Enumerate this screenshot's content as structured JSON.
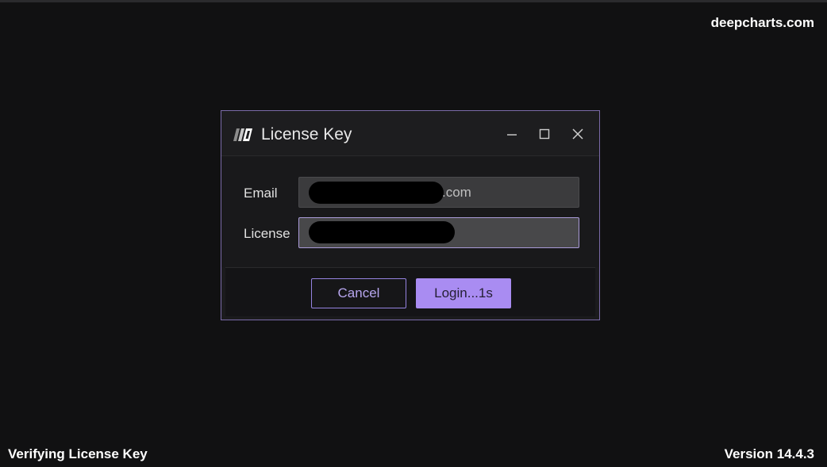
{
  "app": {
    "brand": "deepcharts.com",
    "status": "Verifying License Key",
    "version": "Version 14.4.3"
  },
  "dialog": {
    "title": "License Key",
    "icons": {
      "logo": "deepcharts-logo-icon",
      "minimize": "minimize-icon",
      "maximize": "maximize-icon",
      "close": "close-icon"
    },
    "email": {
      "label": "Email",
      "value_visible_suffix": ".com"
    },
    "license": {
      "label": "License"
    },
    "buttons": {
      "cancel": "Cancel",
      "login": "Login...1s"
    }
  },
  "colors": {
    "accent": "#a98cf2",
    "accent_border": "#7a6aa8",
    "background": "#111112"
  }
}
